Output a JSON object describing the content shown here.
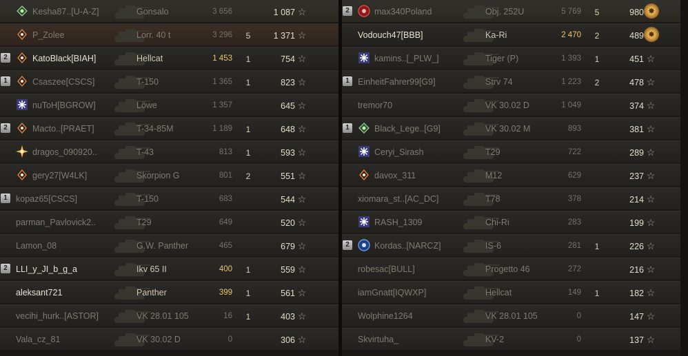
{
  "left_team": [
    {
      "platoon": "",
      "emblem": "green-diamond-icon",
      "name": "Kesha87..[U-A-Z]",
      "tank": "Gonsalo",
      "xp": "3 656",
      "xp_gold": false,
      "kills": "",
      "damage": "1 087",
      "icon": "star-icon",
      "style": "hl",
      "alive": false
    },
    {
      "platoon": "",
      "emblem": "orange-diamond-icon",
      "name": "P_Zolee",
      "tank": "Lorr. 40 t",
      "xp": "3 296",
      "xp_gold": false,
      "kills": "5",
      "damage": "1 371",
      "icon": "star-icon",
      "style": "me",
      "alive": false
    },
    {
      "platoon": "2",
      "emblem": "orange-diamond-icon",
      "name": "KatoBlack[BIAH]",
      "tank": "Hellcat",
      "xp": "1 453",
      "xp_gold": true,
      "kills": "1",
      "damage": "754",
      "icon": "star-icon",
      "style": "",
      "alive": true
    },
    {
      "platoon": "1",
      "emblem": "orange-diamond-icon",
      "name": "Csaszee[CSCS]",
      "tank": "T-150",
      "xp": "1 365",
      "xp_gold": false,
      "kills": "1",
      "damage": "823",
      "icon": "star-icon",
      "style": "",
      "alive": false
    },
    {
      "platoon": "",
      "emblem": "snowflake-icon",
      "name": "nuToH[BGROW]",
      "tank": "Löwe",
      "xp": "1 357",
      "xp_gold": false,
      "kills": "",
      "damage": "645",
      "icon": "star-icon",
      "style": "",
      "alive": false
    },
    {
      "platoon": "2",
      "emblem": "orange-diamond-icon",
      "name": "Macto..[PRAET]",
      "tank": "T-34-85M",
      "xp": "1 189",
      "xp_gold": false,
      "kills": "1",
      "damage": "648",
      "icon": "star-icon",
      "style": "",
      "alive": false
    },
    {
      "platoon": "",
      "emblem": "yellow-burst-icon",
      "name": "dragos_090920..",
      "tank": "T-43",
      "xp": "813",
      "xp_gold": false,
      "kills": "1",
      "damage": "593",
      "icon": "star-icon",
      "style": "",
      "alive": false
    },
    {
      "platoon": "",
      "emblem": "orange-diamond-icon",
      "name": "gery27[W4LK]",
      "tank": "Skorpion G",
      "xp": "801",
      "xp_gold": false,
      "kills": "2",
      "damage": "551",
      "icon": "star-icon",
      "style": "",
      "alive": false
    },
    {
      "platoon": "1",
      "emblem": "",
      "name": "kopaz65[CSCS]",
      "tank": "T-150",
      "xp": "683",
      "xp_gold": false,
      "kills": "",
      "damage": "544",
      "icon": "star-icon",
      "style": "",
      "alive": false
    },
    {
      "platoon": "",
      "emblem": "",
      "name": "parman_Pavlovick2..",
      "tank": "T29",
      "xp": "649",
      "xp_gold": false,
      "kills": "",
      "damage": "520",
      "icon": "star-icon",
      "style": "",
      "alive": false
    },
    {
      "platoon": "",
      "emblem": "",
      "name": "Lamon_08",
      "tank": "G.W. Panther",
      "xp": "465",
      "xp_gold": false,
      "kills": "",
      "damage": "679",
      "icon": "star-icon",
      "style": "",
      "alive": false
    },
    {
      "platoon": "2",
      "emblem": "",
      "name": "LLI_y_JI_b_g_a",
      "tank": "Ikv 65 II",
      "xp": "400",
      "xp_gold": true,
      "kills": "1",
      "damage": "559",
      "icon": "star-icon",
      "style": "",
      "alive": true
    },
    {
      "platoon": "",
      "emblem": "",
      "name": "aleksant721",
      "tank": "Panther",
      "xp": "399",
      "xp_gold": true,
      "kills": "1",
      "damage": "561",
      "icon": "star-icon",
      "style": "",
      "alive": true
    },
    {
      "platoon": "",
      "emblem": "",
      "name": "vecihi_hurk..[ASTOR]",
      "tank": "VK 28.01 105",
      "xp": "16",
      "xp_gold": false,
      "kills": "1",
      "damage": "403",
      "icon": "star-icon",
      "style": "",
      "alive": false
    },
    {
      "platoon": "",
      "emblem": "",
      "name": "Vala_cz_81",
      "tank": "VK 30.02 D",
      "xp": "0",
      "xp_gold": false,
      "kills": "",
      "damage": "306",
      "icon": "star-icon",
      "style": "",
      "alive": false
    }
  ],
  "right_team": [
    {
      "platoon": "2",
      "emblem": "red-circle-icon",
      "name": "max340Poland",
      "tank": "Obj. 252U",
      "xp": "5 769",
      "xp_gold": false,
      "kills": "5",
      "damage": "980",
      "icon": "medal-icon",
      "style": "hl",
      "alive": false
    },
    {
      "platoon": "",
      "emblem": "",
      "name": "Vodouch47[BBB]",
      "tank": "Ka-Ri",
      "xp": "2 470",
      "xp_gold": true,
      "kills": "2",
      "damage": "489",
      "icon": "medal-icon",
      "style": "",
      "alive": true
    },
    {
      "platoon": "",
      "emblem": "snowflake-icon",
      "name": "kamins..[_PLW_]",
      "tank": "Tiger (P)",
      "xp": "1 393",
      "xp_gold": false,
      "kills": "1",
      "damage": "451",
      "icon": "star-icon",
      "style": "",
      "alive": false
    },
    {
      "platoon": "1",
      "emblem": "",
      "name": "EinheitFahrer99[G9]",
      "tank": "Strv 74",
      "xp": "1 223",
      "xp_gold": false,
      "kills": "2",
      "damage": "478",
      "icon": "star-icon",
      "style": "",
      "alive": false
    },
    {
      "platoon": "",
      "emblem": "",
      "name": "tremor70",
      "tank": "VK 30.02 D",
      "xp": "1 049",
      "xp_gold": false,
      "kills": "",
      "damage": "374",
      "icon": "star-icon",
      "style": "",
      "alive": false
    },
    {
      "platoon": "1",
      "emblem": "green-diamond-icon",
      "name": "Black_Lege..[G9]",
      "tank": "VK 30.02 M",
      "xp": "893",
      "xp_gold": false,
      "kills": "",
      "damage": "381",
      "icon": "star-icon",
      "style": "",
      "alive": false
    },
    {
      "platoon": "",
      "emblem": "snowflake-icon",
      "name": "Ceryi_Sirash",
      "tank": "T29",
      "xp": "722",
      "xp_gold": false,
      "kills": "",
      "damage": "289",
      "icon": "star-icon",
      "style": "",
      "alive": false
    },
    {
      "platoon": "",
      "emblem": "orange-diamond-icon",
      "name": "davox_311",
      "tank": "M12",
      "xp": "629",
      "xp_gold": false,
      "kills": "",
      "damage": "237",
      "icon": "star-icon",
      "style": "",
      "alive": false
    },
    {
      "platoon": "",
      "emblem": "",
      "name": "xiomara_st..[AC_DC]",
      "tank": "T78",
      "xp": "378",
      "xp_gold": false,
      "kills": "",
      "damage": "214",
      "icon": "star-icon",
      "style": "",
      "alive": false
    },
    {
      "platoon": "",
      "emblem": "snowflake-icon",
      "name": "RASH_1309",
      "tank": "Chi-Ri",
      "xp": "283",
      "xp_gold": false,
      "kills": "",
      "damage": "199",
      "icon": "star-icon",
      "style": "",
      "alive": false
    },
    {
      "platoon": "2",
      "emblem": "blue-circle-icon",
      "name": "Kordas..[NARCZ]",
      "tank": "IS-6",
      "xp": "281",
      "xp_gold": false,
      "kills": "1",
      "damage": "226",
      "icon": "star-icon",
      "style": "",
      "alive": false
    },
    {
      "platoon": "",
      "emblem": "",
      "name": "robesac[BULL]",
      "tank": "Progetto 46",
      "xp": "272",
      "xp_gold": false,
      "kills": "",
      "damage": "216",
      "icon": "star-icon",
      "style": "",
      "alive": false
    },
    {
      "platoon": "",
      "emblem": "",
      "name": "iamGnatt[IQWXP]",
      "tank": "Hellcat",
      "xp": "149",
      "xp_gold": false,
      "kills": "1",
      "damage": "182",
      "icon": "star-icon",
      "style": "",
      "alive": false
    },
    {
      "platoon": "",
      "emblem": "",
      "name": "Wolphine1264",
      "tank": "VK 28.01 105",
      "xp": "0",
      "xp_gold": false,
      "kills": "",
      "damage": "147",
      "icon": "star-icon",
      "style": "",
      "alive": false
    },
    {
      "platoon": "",
      "emblem": "",
      "name": "Skvirtuha_",
      "tank": "KV-2",
      "xp": "0",
      "xp_gold": false,
      "kills": "",
      "damage": "137",
      "icon": "star-icon",
      "style": "",
      "alive": false
    }
  ],
  "colors": {
    "gold_xp": "#e8c66a",
    "highlight_row": "#3b2e25"
  }
}
